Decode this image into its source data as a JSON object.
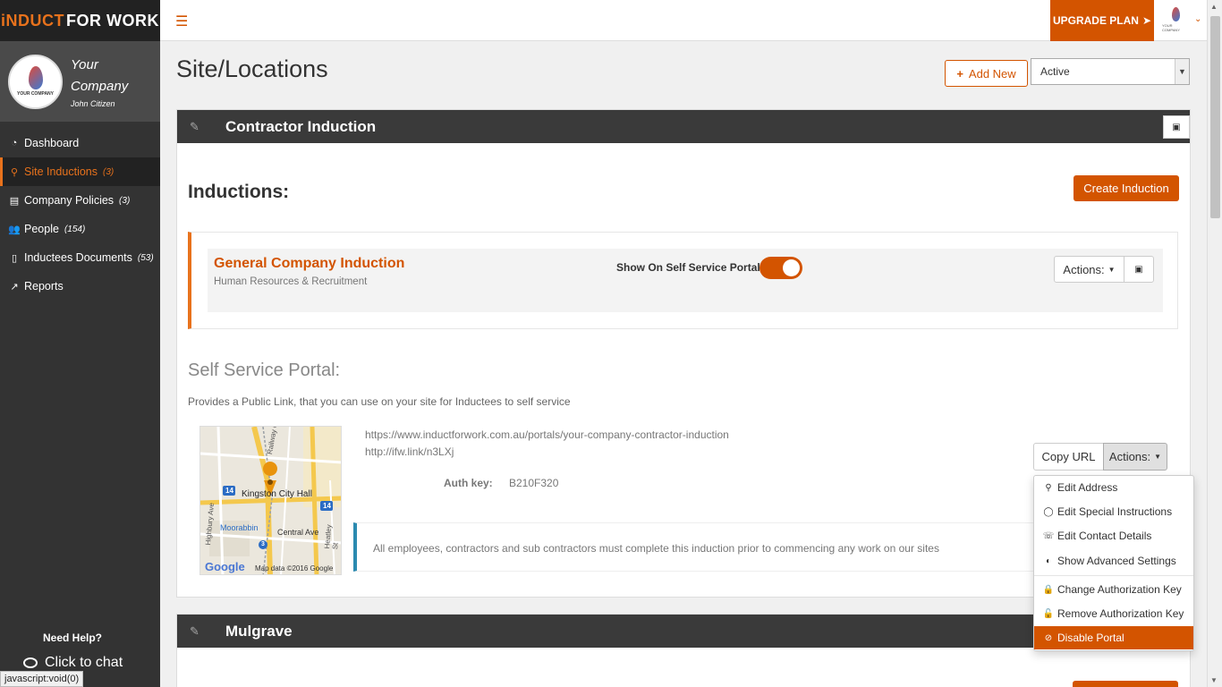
{
  "brand": {
    "part1": "iNDUCT",
    "part2": "FOR WORK",
    "accent_color": "#e8721c"
  },
  "company": {
    "name_line1": "Your",
    "name_line2": "Company",
    "user": "John Citizen",
    "logo_text": "YOUR COMPANY"
  },
  "nav": [
    {
      "label": "Dashboard",
      "count": "",
      "icon": "dashboard-icon",
      "glyph": "◔"
    },
    {
      "label": "Site Inductions",
      "count": "(3)",
      "icon": "map-marker-icon",
      "glyph": "⚲"
    },
    {
      "label": "Company Policies",
      "count": "(3)",
      "icon": "book-icon",
      "glyph": "▤"
    },
    {
      "label": "People",
      "count": "(154)",
      "icon": "users-icon",
      "glyph": "👥"
    },
    {
      "label": "Inductees Documents",
      "count": "(53)",
      "icon": "file-icon",
      "glyph": "▯"
    },
    {
      "label": "Reports",
      "count": "",
      "icon": "chart-line-icon",
      "glyph": "↗"
    }
  ],
  "help": {
    "title": "Need Help?",
    "chat": "Click to chat"
  },
  "statusbar": "javascript:void(0)",
  "topbar": {
    "upgrade": "UPGRADE PLAN"
  },
  "page": {
    "title": "Site/Locations",
    "add_new": "Add New",
    "filter_value": "Active"
  },
  "panel1": {
    "title": "Contractor Induction",
    "inductions_label": "Inductions:",
    "create_induction": "Create Induction",
    "induction": {
      "name": "General Company Induction",
      "department": "Human Resources & Recruitment",
      "self_service_label": "Show On Self Service Portal:",
      "actions": "Actions:"
    },
    "portal": {
      "title": "Self Service Portal:",
      "description": "Provides a Public Link, that you can use on your site for Inductees to self service",
      "url": "https://www.inductforwork.com.au/portals/your-company-contractor-induction",
      "short_url": "http://ifw.link/n3LXj",
      "auth_label": "Auth key:",
      "auth_value": "B210F320",
      "copy_url": "Copy URL",
      "actions": "Actions:",
      "note": "All employees, contractors and sub contractors must complete this induction prior to commencing any work on our sites"
    },
    "map": {
      "place": "Kingston City Hall",
      "streets": [
        "Railway Cres",
        "Highbury Ave",
        "Central Ave",
        "Heatley St",
        "Moorabbin"
      ],
      "route_a": "14",
      "route_b": "3",
      "google": "Google",
      "attribution": "Map data ©2016 Google"
    }
  },
  "dropdown": [
    {
      "label": "Edit Address",
      "icon": "map-marker-icon",
      "glyph": "⚲"
    },
    {
      "label": "Edit Special Instructions",
      "icon": "comment-icon",
      "glyph": "◯"
    },
    {
      "label": "Edit Contact Details",
      "icon": "phone-icon",
      "glyph": "☏"
    },
    {
      "label": "Show Advanced Settings",
      "icon": "toggle-icon",
      "glyph": "◐"
    },
    {
      "label": "Change Authorization Key",
      "icon": "lock-icon",
      "glyph": "🔒"
    },
    {
      "label": "Remove Authorization Key",
      "icon": "unlock-icon",
      "glyph": "🔓"
    },
    {
      "label": "Disable Portal",
      "icon": "ban-icon",
      "glyph": "⊘"
    }
  ],
  "panel2": {
    "title": "Mulgrave"
  },
  "colors": {
    "primary": "#d35400",
    "dark_header": "#3a3a3a",
    "sidebar": "#333333",
    "info_border": "#2b8ab0"
  }
}
